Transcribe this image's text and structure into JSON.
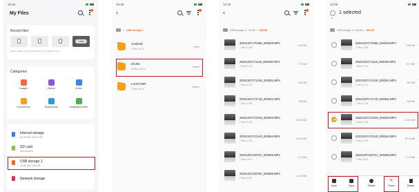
{
  "status_time": "10:35",
  "screen1": {
    "title": "My Files",
    "recent_title": "Recent files",
    "recent_caption": "Movie_data10  10_20  DATA  DATA-ch  TL748  W lot gen",
    "recent_pill": "USB",
    "categories_title": "Categories",
    "categories": [
      {
        "label": "Images",
        "color": "#f36d3c"
      },
      {
        "label": "Videos",
        "color": "#8c56d6"
      },
      {
        "label": "Audio",
        "color": "#3a8be0"
      },
      {
        "label": "Documents",
        "color": "#f4a01c"
      },
      {
        "label": "Downloads",
        "color": "#2b9bd8"
      },
      {
        "label": "Installation files",
        "color": "#4caf50"
      }
    ],
    "storage": [
      {
        "name": "Internal storage",
        "sub": "82.28 GB / 64.00 GB",
        "color": "#3a7ee0"
      },
      {
        "name": "SD card",
        "sub": "Not inserted",
        "color": "#8cbf3f"
      },
      {
        "name": "USB storage 1",
        "sub": "78.80 GB / 116 GB",
        "color": "#f26a1b"
      },
      {
        "name": "Network storage",
        "sub": "",
        "color": "#e0324b"
      }
    ]
  },
  "screen2": {
    "crumb_current": "USB storage 1",
    "folders": [
      {
        "name": "Android",
        "date": "7 Dec 19:37",
        "count": "1 item"
      },
      {
        "name": "DCIM",
        "date": "20 Nov 18:14",
        "count": "2 items"
      },
      {
        "name": "LOST.DIR",
        "date": "7 Dec 19:37",
        "count": "0 items"
      }
    ]
  },
  "screen3": {
    "crumb_path": "USB storage 1  >  DCIM  >",
    "crumb_current": "MOVIE",
    "videos": [
      {
        "name": "20231207170458_000349.MP4",
        "date": "7 Dec 17:05",
        "size": "9.46 MB"
      },
      {
        "name": "20231207171119_000350.MP4",
        "date": "7 Dec 17:14",
        "size": "277 MB"
      },
      {
        "name": "20231207171418_000351.MP4",
        "date": "7 Dec 17:17",
        "size": "259 MB"
      },
      {
        "name": "20231207171719_000352.MP4",
        "date": "7 Dec 17:20",
        "size": "258 MB"
      },
      {
        "name": "20231207172019_000353.MP4",
        "date": "7 Dec 17:20",
        "size": "49.63 MB"
      },
      {
        "name": "20231207172140_000354.MP4",
        "date": "7 Dec 17:22",
        "size": "18.44 MB"
      },
      {
        "name": "20231207193721_000355.MP4",
        "date": "7 Dec 19:37",
        "size": "4.13 MB"
      },
      {
        "name": "20231207193753_000356.MP4",
        "date": "7 Dec 19:37",
        "size": "10.42 MB"
      }
    ]
  },
  "screen4": {
    "title": "1 selected",
    "all_label": "All",
    "crumb_path": "USB storage 1  >  DCIM  >",
    "crumb_current": "MOVIE",
    "videos": [
      {
        "name": "20231207170458_000349.MP4",
        "date": "7 Dec 17:05",
        "size": "9.46 MB"
      },
      {
        "name": "20231207171119_000350.MP4",
        "date": "7 Dec 17:14",
        "size": "277 MB"
      },
      {
        "name": "20231207171418_000351.MP4",
        "date": "7 Dec 17:17",
        "size": "259 MB"
      },
      {
        "name": "20231207171719_000352.MP4",
        "date": "7 Dec 17:20",
        "size": "258 MB"
      },
      {
        "name": "20231207172019_000353.MP4",
        "date": "7 Dec 17:20",
        "size": "49.63 MB"
      },
      {
        "name": "20231207172140_000354.MP4",
        "date": "7 Dec 17:22",
        "size": "18.44 MB"
      },
      {
        "name": "20231207193721_000355.MP4",
        "date": "7 Dec 19:37",
        "size": "4.13 MB"
      }
    ],
    "actions": [
      "Move",
      "Copy",
      "Details",
      "Share",
      "Delete"
    ]
  }
}
